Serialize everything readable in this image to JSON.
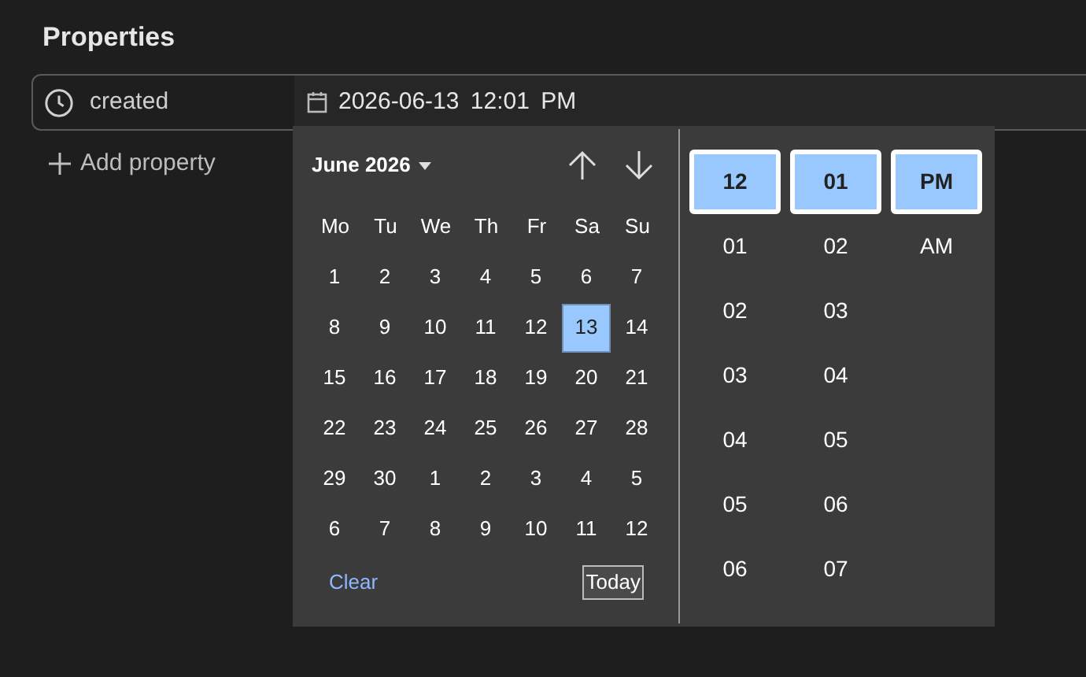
{
  "heading": "Properties",
  "property": {
    "name": "created",
    "value": "2026-06-13 12:01 PM"
  },
  "add_property": "Add property",
  "picker": {
    "month_label": "June 2026",
    "weekdays": [
      "Mo",
      "Tu",
      "We",
      "Th",
      "Fr",
      "Sa",
      "Su"
    ],
    "days": [
      {
        "label": "1",
        "selected": false
      },
      {
        "label": "2",
        "selected": false
      },
      {
        "label": "3",
        "selected": false
      },
      {
        "label": "4",
        "selected": false
      },
      {
        "label": "5",
        "selected": false
      },
      {
        "label": "6",
        "selected": false
      },
      {
        "label": "7",
        "selected": false
      },
      {
        "label": "8",
        "selected": false
      },
      {
        "label": "9",
        "selected": false
      },
      {
        "label": "10",
        "selected": false
      },
      {
        "label": "11",
        "selected": false
      },
      {
        "label": "12",
        "selected": false
      },
      {
        "label": "13",
        "selected": true
      },
      {
        "label": "14",
        "selected": false
      },
      {
        "label": "15",
        "selected": false
      },
      {
        "label": "16",
        "selected": false
      },
      {
        "label": "17",
        "selected": false
      },
      {
        "label": "18",
        "selected": false
      },
      {
        "label": "19",
        "selected": false
      },
      {
        "label": "20",
        "selected": false
      },
      {
        "label": "21",
        "selected": false
      },
      {
        "label": "22",
        "selected": false
      },
      {
        "label": "23",
        "selected": false
      },
      {
        "label": "24",
        "selected": false
      },
      {
        "label": "25",
        "selected": false
      },
      {
        "label": "26",
        "selected": false
      },
      {
        "label": "27",
        "selected": false
      },
      {
        "label": "28",
        "selected": false
      },
      {
        "label": "29",
        "selected": false
      },
      {
        "label": "30",
        "selected": false
      },
      {
        "label": "1",
        "selected": false
      },
      {
        "label": "2",
        "selected": false
      },
      {
        "label": "3",
        "selected": false
      },
      {
        "label": "4",
        "selected": false
      },
      {
        "label": "5",
        "selected": false
      },
      {
        "label": "6",
        "selected": false
      },
      {
        "label": "7",
        "selected": false
      },
      {
        "label": "8",
        "selected": false
      },
      {
        "label": "9",
        "selected": false
      },
      {
        "label": "10",
        "selected": false
      },
      {
        "label": "11",
        "selected": false
      },
      {
        "label": "12",
        "selected": false
      }
    ],
    "clear": "Clear",
    "today": "Today",
    "time_columns": [
      [
        {
          "label": "12",
          "selected": true
        },
        {
          "label": "01",
          "selected": false
        },
        {
          "label": "02",
          "selected": false
        },
        {
          "label": "03",
          "selected": false
        },
        {
          "label": "04",
          "selected": false
        },
        {
          "label": "05",
          "selected": false
        },
        {
          "label": "06",
          "selected": false
        }
      ],
      [
        {
          "label": "01",
          "selected": true
        },
        {
          "label": "02",
          "selected": false
        },
        {
          "label": "03",
          "selected": false
        },
        {
          "label": "04",
          "selected": false
        },
        {
          "label": "05",
          "selected": false
        },
        {
          "label": "06",
          "selected": false
        },
        {
          "label": "07",
          "selected": false
        }
      ],
      [
        {
          "label": "PM",
          "selected": true
        },
        {
          "label": "AM",
          "selected": false
        }
      ]
    ]
  }
}
